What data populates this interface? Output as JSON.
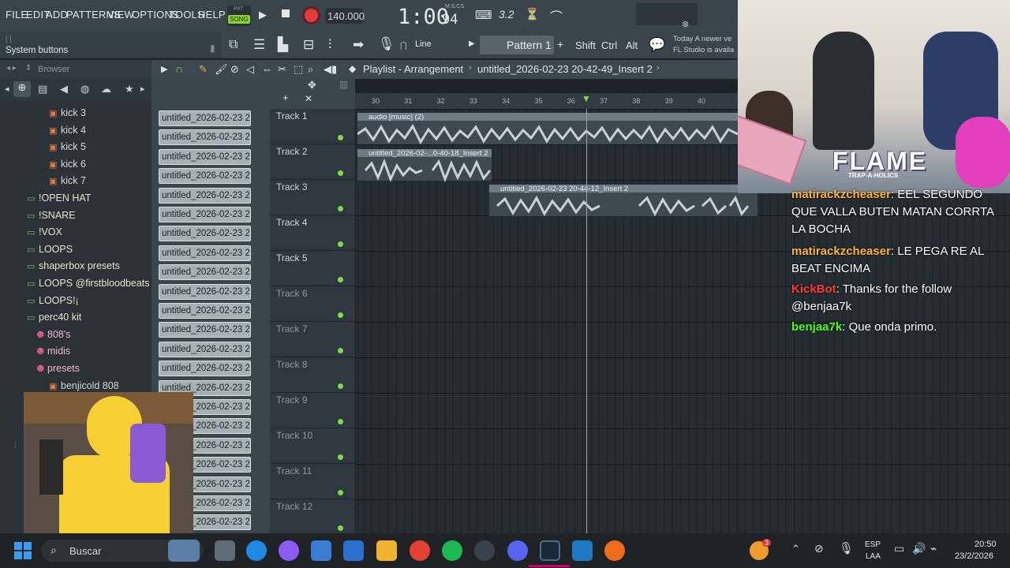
{
  "menu": [
    "FILE",
    "EDIT",
    "ADD",
    "PATTERNS",
    "VIEW",
    "OPTIONS",
    "TOOLS",
    "HELP"
  ],
  "transport": {
    "pat_label": "PAT",
    "song_label": "SONG",
    "tempo": "140.000",
    "time": "1:00",
    "time_sub": "94",
    "time_unit": "M:S:CS",
    "cpu": "3.2"
  },
  "hint": {
    "left": "System buttons",
    "news_1": "Today  A newer ve",
    "news_2": "FL Studio is availa"
  },
  "toolbar": {
    "line_label": "Line",
    "pattern_label": "Pattern 1",
    "shift": "Shift",
    "ctrl": "Ctrl",
    "alt": "Alt"
  },
  "browser": {
    "title": "Browser",
    "items": [
      {
        "label": "kick 3",
        "kind": "file"
      },
      {
        "label": "kick 4",
        "kind": "file"
      },
      {
        "label": "kick 5",
        "kind": "file"
      },
      {
        "label": "kick 6",
        "kind": "file"
      },
      {
        "label": "kick 7",
        "kind": "file"
      },
      {
        "label": "!OPEN HAT",
        "kind": "folder"
      },
      {
        "label": "!SNARE",
        "kind": "folder"
      },
      {
        "label": "!VOX",
        "kind": "folder"
      },
      {
        "label": "LOOPS",
        "kind": "folder"
      },
      {
        "label": "shaperbox presets",
        "kind": "folder"
      },
      {
        "label": "LOOPS @firstbloodbeats",
        "kind": "folder"
      },
      {
        "label": "LOOPS!¡",
        "kind": "folder"
      },
      {
        "label": "perc40 kit",
        "kind": "folder"
      },
      {
        "label": "808's",
        "kind": "pink"
      },
      {
        "label": "midis",
        "kind": "pink"
      },
      {
        "label": "presets",
        "kind": "pink"
      },
      {
        "label": "benjicold 808",
        "kind": "file"
      }
    ]
  },
  "playlist": {
    "title": "Playlist - Arrangement",
    "pattern": "untitled_2026-02-23 20-42-49_Insert 2",
    "ruler": [
      "30",
      "31",
      "32",
      "33",
      "34",
      "35",
      "36",
      "37",
      "38",
      "39",
      "40"
    ],
    "clip_label": "untitled_2026-02-23 20-...",
    "tracks": [
      "Track 1",
      "Track 2",
      "Track 3",
      "Track 4",
      "Track 5",
      "Track 6",
      "Track 7",
      "Track 8",
      "Track 9",
      "Track 10",
      "Track 11",
      "Track 12"
    ],
    "audio_clips": [
      "audio [music] (2)",
      "untitled_2026-02-...0-40-18_Insert 2",
      "untitled_2026-02-23 20-44-12_Insert 2"
    ]
  },
  "stream": {
    "banner": "FLAME",
    "banner_sub": "TRAP-A-HOLICS",
    "chat": [
      {
        "user": "matirackzcheaser",
        "msg": "EEL SEGUNDO QUE VALLA BUTEN MATAN CORRTA LA BOCHA",
        "color": "#ffb733"
      },
      {
        "user": "matirackzcheaser",
        "msg": "LE PEGA RE AL BEAT ENCIMA",
        "color": "#ffb733"
      },
      {
        "user": "KickBot",
        "msg": "Thanks for the follow @benjaa7k",
        "color": "#ff3b3b"
      },
      {
        "user": "benjaa7k",
        "msg": "Que onda primo.",
        "color": "#53fc18"
      }
    ]
  },
  "taskbar": {
    "search": "Buscar",
    "lang_1": "ESP",
    "lang_2": "LAA",
    "time": "20:50",
    "date": "23/2/2026",
    "badge": "3"
  },
  "colors": {
    "accent_green": "#7fd94a",
    "record": "#e6393e",
    "panel": "#3a444b"
  }
}
